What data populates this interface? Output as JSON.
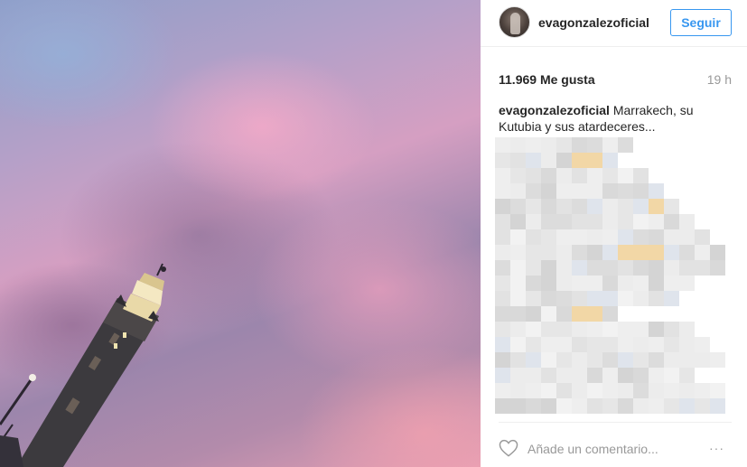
{
  "post": {
    "photo_alt": "Marrakech, su Kutubia y sus atardeceres",
    "author": {
      "username": "evagonzalezoficial"
    },
    "follow_label": "Seguir",
    "likes_text": "11.969 Me gusta",
    "time_text": "19 h",
    "caption": {
      "user": "evagonzalezoficial",
      "text": "Marrakech, su Kutubia y sus atardeceres..."
    },
    "comment_placeholder": "Añade un comentario...",
    "more_label": "···"
  },
  "icons": {
    "heart": "heart-outline-icon",
    "more": "more-options-icon"
  },
  "colors": {
    "accent": "#3897f0",
    "meta": "#999999",
    "text": "#262626"
  }
}
